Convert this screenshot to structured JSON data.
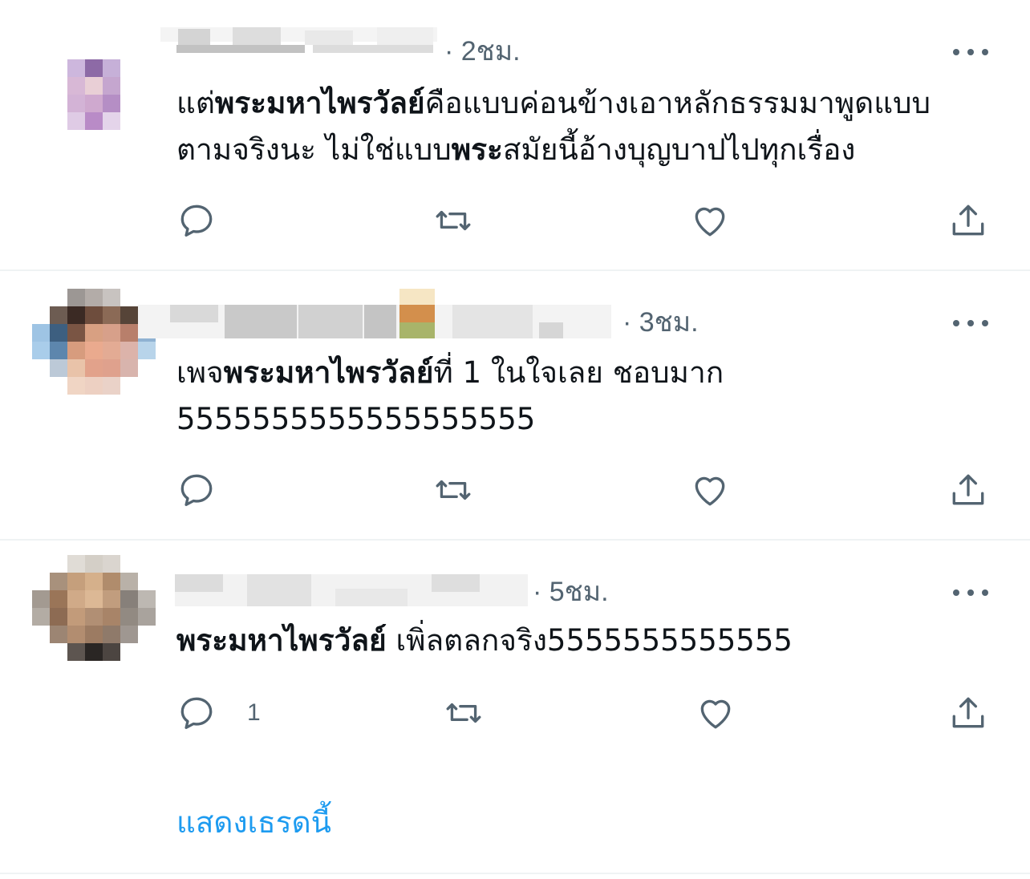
{
  "tweets": [
    {
      "time": "· 2ชม.",
      "text_parts": [
        {
          "t": "แต่",
          "b": false
        },
        {
          "t": "พระมหาไพรวัลย์",
          "b": true
        },
        {
          "t": "คือแบบค่อนข้างเอาหลักธรรมมาพูดแบบ",
          "b": false
        }
      ],
      "text_line2_parts": [
        {
          "t": "ตามจริงนะ ไม่ใช่แบบ",
          "b": false
        },
        {
          "t": "พระ",
          "b": true
        },
        {
          "t": "สมัยนี้อ้างบุญบาปไปทุกเรื่อง",
          "b": false
        }
      ],
      "reply_count": ""
    },
    {
      "time": "· 3ชม.",
      "text_parts": [
        {
          "t": "เพจ",
          "b": false
        },
        {
          "t": "พระมหาไพรวัลย์",
          "b": true
        },
        {
          "t": "ที่ 1 ในใจเลย ชอบมาก",
          "b": false
        }
      ],
      "text_line2_parts": [
        {
          "t": "5555555555555555555",
          "b": false
        }
      ],
      "reply_count": ""
    },
    {
      "time": "· 5ชม.",
      "text_parts": [
        {
          "t": "พระมหาไพรวัลย์",
          "b": true
        },
        {
          "t": " เพิ่ลตลกจริง5555555555555",
          "b": false
        }
      ],
      "text_line2_parts": [],
      "reply_count": "1"
    }
  ],
  "show_thread": "แสดงเธรดนี้",
  "colors": {
    "accent": "#1d9bf0",
    "muted": "#536471",
    "divider": "#eff3f4"
  },
  "icons": [
    "reply-icon",
    "retweet-icon",
    "like-icon",
    "share-icon",
    "more-icon"
  ]
}
